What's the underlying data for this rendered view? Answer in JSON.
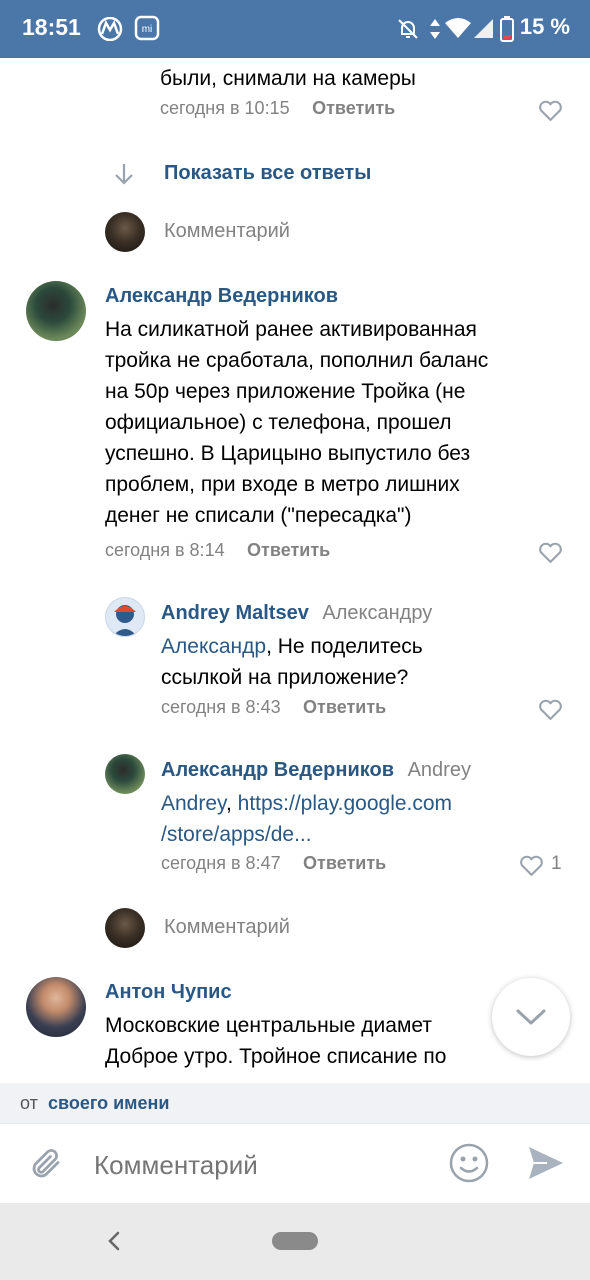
{
  "status_bar": {
    "time": "18:51",
    "battery": "15 %",
    "icons": [
      "metro-logo-icon",
      "mi-app-icon",
      "bell-muted-icon",
      "data-arrows-icon",
      "wifi-icon",
      "signal-icon",
      "battery-low-icon"
    ]
  },
  "top_comment": {
    "text_tail": "были, снимали на камеры",
    "time": "сегодня в 10:15",
    "reply_label": "Ответить"
  },
  "show_all_replies": "Показать все ответы",
  "comment_input_1": "Комментарий",
  "comment_1": {
    "author": "Александр Ведерников",
    "text": "На силикатной ранее активированная тройка не сработала, пополнил баланс на 50р через приложение Тройка (не официальное) с телефона, прошел успешно. В Царицыно выпустило без проблем, при входе в метро лишних денег не списали (\"пересадка\")",
    "lines": [
      "На силикатной ранее активированная",
      "тройка не сработала, пополнил баланс",
      "на 50р через приложение Тройка (не",
      "официальное) с телефона, прошел",
      "успешно. В Царицыно выпустило без",
      "проблем, при входе в метро лишних",
      "денег не списали (\"пересадка\")"
    ],
    "time": "сегодня в 8:14",
    "reply_label": "Ответить"
  },
  "reply_1": {
    "author": "Andrey Maltsev",
    "to": "Александру",
    "mention": "Александр",
    "text_after_mention": ", Не поделитесь",
    "line2": "ссылкой на приложение?",
    "time": "сегодня в 8:43",
    "reply_label": "Ответить"
  },
  "reply_2": {
    "author": "Александр Ведерников",
    "to": "Andrey",
    "mention": "Andrey",
    "link_line1": "https://play.google.com",
    "link_line2": "/store/apps/de...",
    "time": "сегодня в 8:47",
    "reply_label": "Ответить",
    "likes": "1"
  },
  "comment_input_2": "Комментарий",
  "comment_2": {
    "author": "Антон Чупис",
    "group_link": "Московские центральные диамет",
    "text_line1": "Доброе утро. Тройное списание по"
  },
  "from_bar": {
    "prefix": "от",
    "link": "своего имени"
  },
  "input": {
    "placeholder": "Комментарий"
  },
  "colors": {
    "accent": "#4a76a8",
    "link": "#2a5885",
    "secondary": "#828282",
    "icon": "#99a2ad"
  }
}
